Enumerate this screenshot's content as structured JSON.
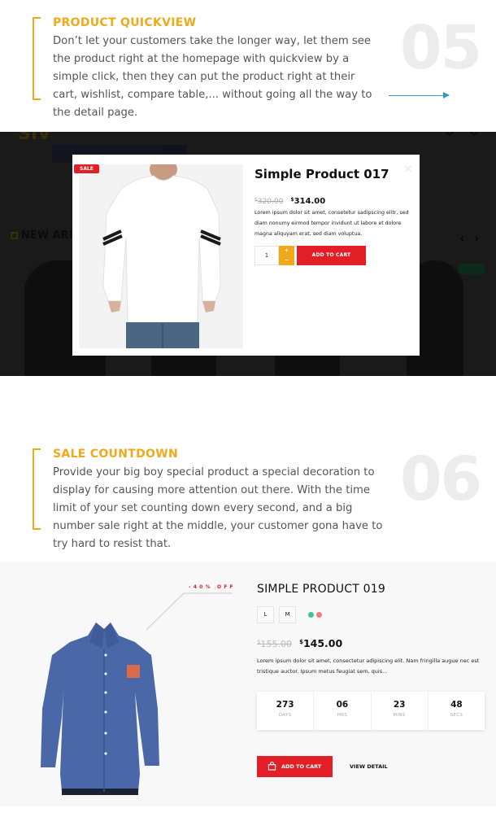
{
  "feature_quickview": {
    "number": "05",
    "title": "PRODUCT QUICKVIEW",
    "description": "Don’t let your customers take the longer way, let them see the product right at the homepage with quickview by a simple click, then they can put the product right at their cart, wishlist, compare table,... without going all the way to the detail page.",
    "accent_color": "#f0a91d",
    "arrow_color": "#3c97c0"
  },
  "quickview_background": {
    "logo": "SIV",
    "section_heading": "NEW ARRI",
    "prev_icon": "‹",
    "next_icon": "›"
  },
  "quickview_modal": {
    "badge": "SALE",
    "close_icon": "×",
    "product_title": "Simple Product 017",
    "currency": "$",
    "old_price": "320.00",
    "new_price": "314.00",
    "description": "Lorem ipsum dolor sit amet, consetetur sadipscing elitr, sed diam nonumy eirmod tempor invidunt ut labore et dolore magna aliquyam erat, sed diam voluptua.",
    "quantity": "1",
    "increment_icon": "+",
    "decrement_icon": "–",
    "add_to_cart_label": "ADD TO CART",
    "colors": {
      "sale": "#e21f26",
      "stepper": "#f3a81b",
      "button": "#e21f26"
    }
  },
  "feature_countdown": {
    "number": "06",
    "title": "SALE COUNTDOWN",
    "description": "Provide your big boy special product a special decoration to display for causing more attention out there. With the time limit of your set counting down every second, and a big number sale right at the middle, your customer gona have to try hard to resist that."
  },
  "countdown_product": {
    "discount_label": "-40% OFF",
    "title": "SIMPLE PRODUCT 019",
    "sizes": [
      "L",
      "M"
    ],
    "swatches": [
      "#3cc48f",
      "#f27a7a"
    ],
    "currency": "$",
    "old_price": "155.00",
    "new_price": "145.00",
    "description": "Lorem ipsum dolor sit amet, consectetur adipiscing elit. Nam fringilla augue nec est tristique auctor. Ipsum metus feugiat sem, quis...",
    "countdown": [
      {
        "value": "273",
        "label": "DAYS"
      },
      {
        "value": "06",
        "label": "HRS"
      },
      {
        "value": "23",
        "label": "MINS"
      },
      {
        "value": "48",
        "label": "SECS"
      }
    ],
    "add_to_cart_label": "ADD TO CART",
    "view_detail_label": "VIEW DETAIL"
  }
}
